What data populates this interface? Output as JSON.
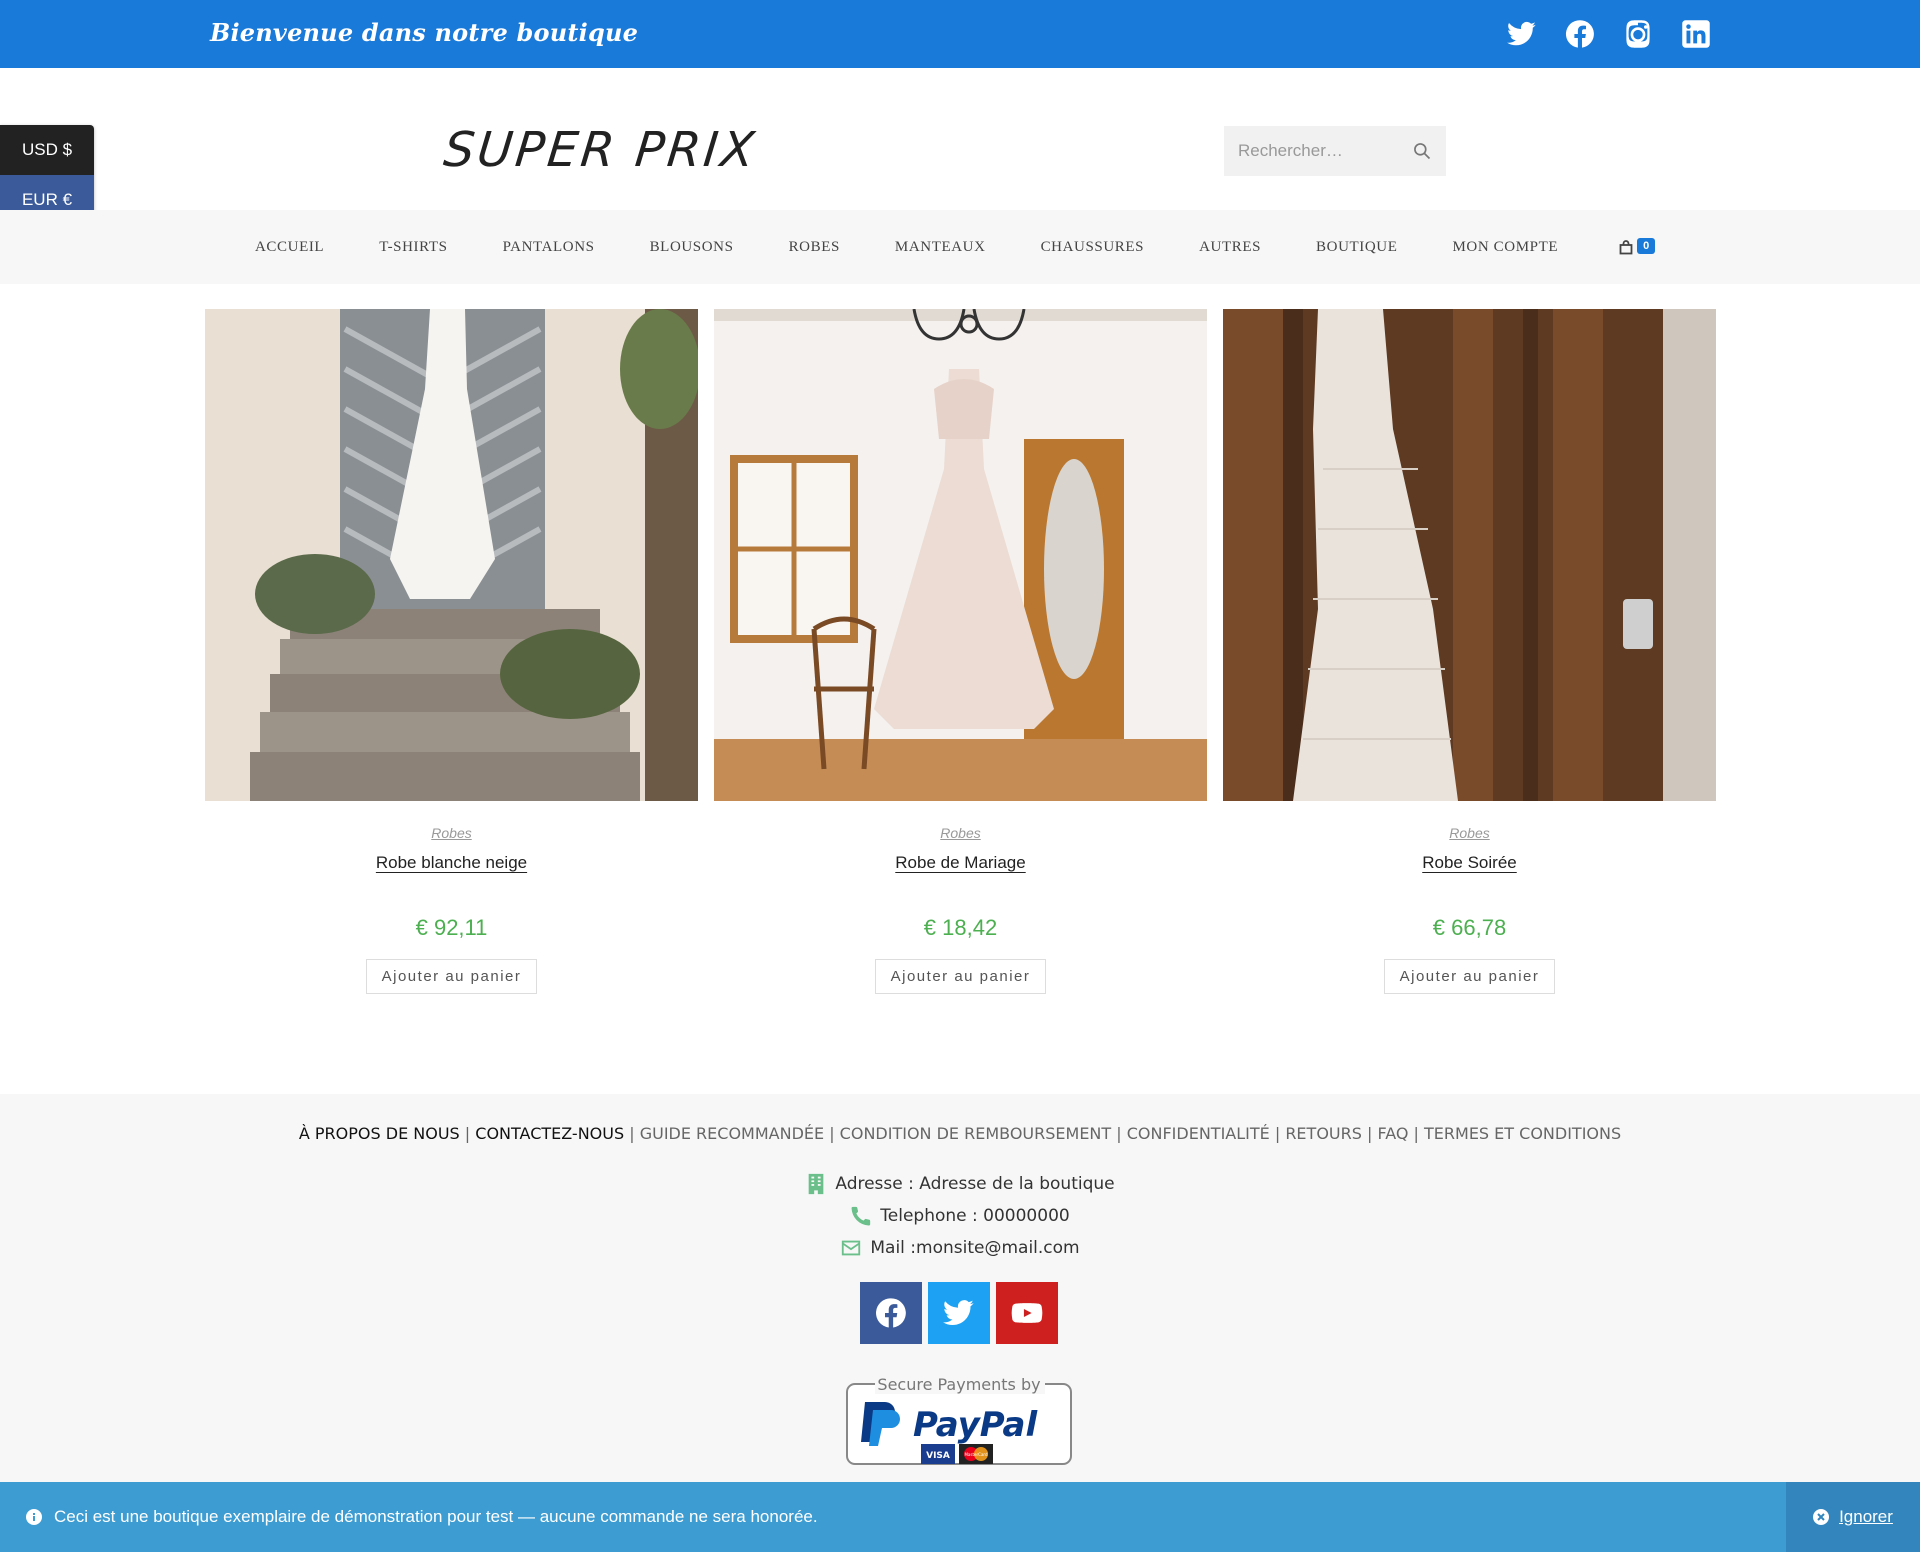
{
  "topbar": {
    "welcome": "Bienvenue dans notre boutique",
    "socials": [
      "twitter-icon",
      "facebook-icon",
      "instagram-icon",
      "linkedin-icon"
    ],
    "bg_color": "#1a7ad9"
  },
  "currency": {
    "usd": "USD $",
    "eur": "EUR €"
  },
  "header": {
    "logo": "SUPER PRIX",
    "search_placeholder": "Rechercher…"
  },
  "nav": {
    "items": [
      "ACCUEIL",
      "T-SHIRTS",
      "PANTALONS",
      "BLOUSONS",
      "ROBES",
      "MANTEAUX",
      "CHAUSSURES",
      "AUTRES",
      "BOUTIQUE",
      "MON COMPTE"
    ],
    "cart_count": "0"
  },
  "products": [
    {
      "category": "Robes",
      "name": "Robe blanche neige",
      "price": "€ 92,11",
      "button": "Ajouter au panier"
    },
    {
      "category": "Robes",
      "name": "Robe de Mariage",
      "price": "€ 18,42",
      "button": "Ajouter au panier"
    },
    {
      "category": "Robes",
      "name": "Robe Soirée",
      "price": "€ 66,78",
      "button": "Ajouter au panier"
    }
  ],
  "footer": {
    "links": [
      "À PROPOS DE NOUS",
      "CONTACTEZ-NOUS",
      "GUIDE RECOMMANDÉE",
      "CONDITION DE REMBOURSEMENT",
      "CONFIDENTIALITÉ",
      "RETOURS",
      "FAQ",
      "TERMES ET CONDITIONS"
    ],
    "address": "Adresse : Adresse de la boutique",
    "phone": "Telephone : 00000000",
    "mail": "Mail :monsite@mail.com",
    "paypal_top": "Secure Payments by",
    "paypal_brand": "PayPal",
    "paypal_cards": [
      "VISA",
      "MasterCard"
    ],
    "accent_color": "#6bbf8a"
  },
  "notice": {
    "message": "Ceci est une boutique exemplaire de démonstration pour test — aucune commande ne sera honorée.",
    "dismiss": "Ignorer"
  }
}
